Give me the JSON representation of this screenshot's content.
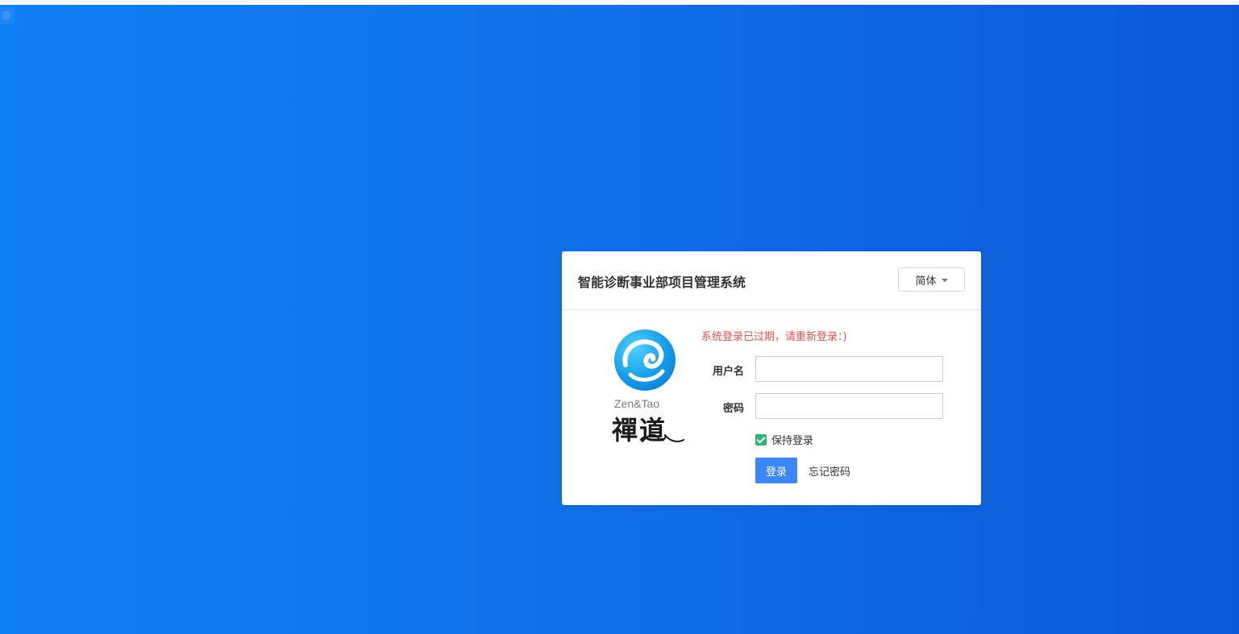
{
  "header": {
    "title": "智能诊断事业部项目管理系统",
    "language_label": "简体"
  },
  "logo": {
    "english": "Zen&Tao",
    "chinese": "禪道"
  },
  "form": {
    "error_message": "系统登录已过期，请重新登录：)",
    "username_label": "用户名",
    "username_value": "",
    "password_label": "密码",
    "password_value": "",
    "keep_login_label": "保持登录",
    "keep_login_checked": true,
    "login_button": "登录",
    "forgot_password": "忘记密码"
  },
  "colors": {
    "background_start": "#0f7ff4",
    "background_end": "#0b59d7",
    "primary_button": "#3a87f7",
    "error_text": "#e5534b",
    "checkbox": "#2bb673"
  },
  "icons": {
    "language_dropdown": "caret-down-icon",
    "keep_login": "checkbox-checked-icon",
    "logo": "zentao-logo"
  }
}
